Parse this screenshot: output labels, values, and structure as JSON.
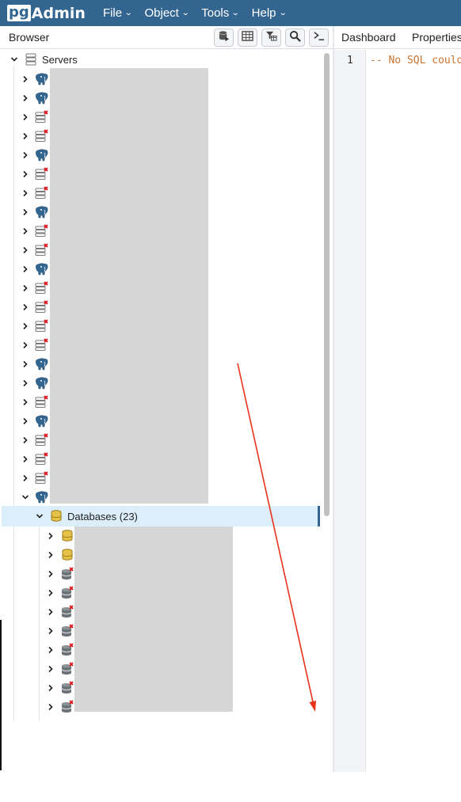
{
  "app": {
    "logo_pg": "pg",
    "logo_admin": "Admin"
  },
  "menu": [
    {
      "label": "File"
    },
    {
      "label": "Object"
    },
    {
      "label": "Tools"
    },
    {
      "label": "Help"
    }
  ],
  "browser": {
    "title": "Browser",
    "toolbar": [
      "query-tool-icon",
      "view-data-icon",
      "filter-rows-icon",
      "search-objects-icon",
      "psql-tool-icon"
    ]
  },
  "tree": {
    "root_label": "Servers",
    "server_icons": [
      "elephant",
      "elephant",
      "disconnected",
      "disconnected",
      "elephant",
      "disconnected",
      "disconnected",
      "elephant",
      "disconnected",
      "disconnected",
      "elephant",
      "disconnected",
      "disconnected",
      "disconnected",
      "disconnected",
      "elephant",
      "elephant",
      "disconnected",
      "elephant",
      "disconnected",
      "disconnected",
      "disconnected",
      "elephant"
    ],
    "databases_label": "Databases (23)",
    "database_icons": [
      "connected",
      "connected",
      "disconnected",
      "disconnected",
      "disconnected",
      "disconnected",
      "disconnected",
      "disconnected",
      "disconnected",
      "disconnected"
    ]
  },
  "tabs": [
    {
      "label": "Dashboard"
    },
    {
      "label": "Properties"
    }
  ],
  "editor": {
    "line_number": "1",
    "code": "-- No SQL could be generated for the selected object."
  },
  "colors": {
    "topbar": "#326690",
    "selected_row": "#dbeefa",
    "annotation_arrow": "#e8331c",
    "code_comment": "#c9732e"
  }
}
